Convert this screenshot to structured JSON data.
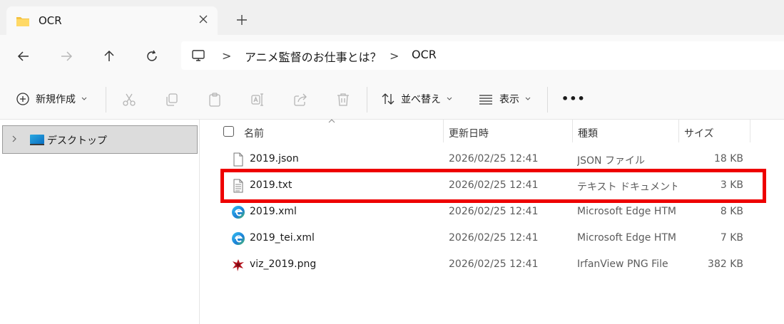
{
  "tab": {
    "title": "OCR"
  },
  "address": {
    "crumbs": [
      "アニメ監督のお仕事とは？",
      "OCR"
    ]
  },
  "commands": {
    "new_label": "新規作成",
    "sort_label": "並べ替え",
    "view_label": "表示",
    "more_label": "•••"
  },
  "nav": {
    "desktop_label": "デスクトップ"
  },
  "columns": {
    "name": "名前",
    "date": "更新日時",
    "type": "種類",
    "size": "サイズ"
  },
  "files": [
    {
      "name": "2019.json",
      "date": "2026/02/25 12:41",
      "type": "JSON ファイル",
      "size": "18 KB",
      "icon": "json-file-icon"
    },
    {
      "name": "2019.txt",
      "date": "2026/02/25 12:41",
      "type": "テキスト ドキュメント",
      "size": "3 KB",
      "icon": "text-file-icon"
    },
    {
      "name": "2019.xml",
      "date": "2026/02/25 12:41",
      "type": "Microsoft Edge HTML Document",
      "size": "8 KB",
      "icon": "edge-icon"
    },
    {
      "name": "2019_tei.xml",
      "date": "2026/02/25 12:41",
      "type": "Microsoft Edge HTML Document",
      "size": "7 KB",
      "icon": "edge-icon"
    },
    {
      "name": "viz_2019.png",
      "date": "2026/02/25 12:41",
      "type": "IrfanView PNG File",
      "size": "382 KB",
      "icon": "irfanview-icon"
    }
  ],
  "highlight_color": "#ee0000"
}
